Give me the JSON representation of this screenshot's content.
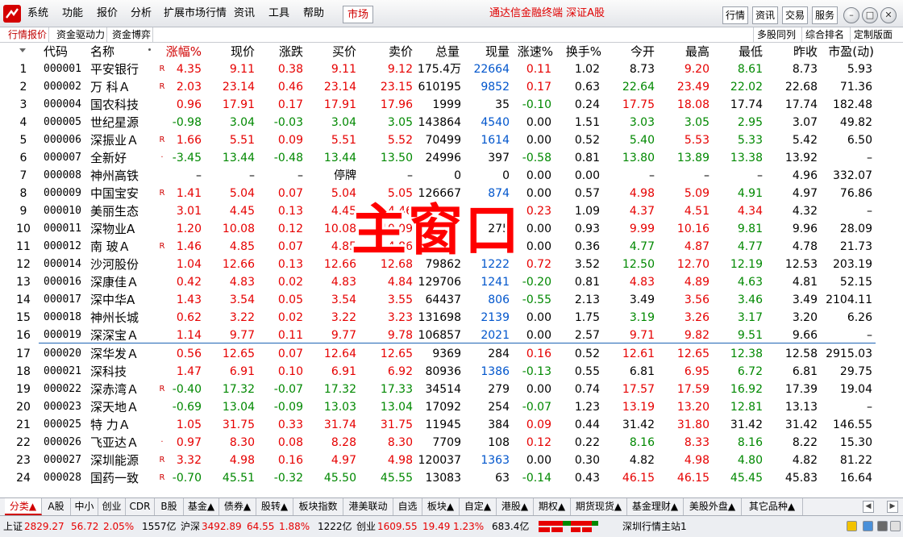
{
  "app": {
    "title": "通达信金融终端  深证A股",
    "market_button": "市场"
  },
  "menu": [
    "系统",
    "功能",
    "报价",
    "分析",
    "扩展市场行情",
    "资讯",
    "工具",
    "帮助"
  ],
  "right_buttons": [
    "行情",
    "资讯",
    "交易",
    "服务"
  ],
  "subtabs": [
    "行情报价",
    "资金驱动力",
    "资金博弈"
  ],
  "subtabs_right": [
    "多股同列",
    "综合排名",
    "定制版面"
  ],
  "columns": [
    "代码",
    "名称",
    "涨幅%",
    "现价",
    "涨跌",
    "买价",
    "卖价",
    "总量",
    "现量",
    "涨速%",
    "换手%",
    "今开",
    "最高",
    "最低",
    "昨收",
    "市盈(动)"
  ],
  "sorted_column": "涨幅%",
  "rows": [
    {
      "idx": "1",
      "code": "000001",
      "name": "平安银行",
      "mark": "R",
      "chg_pct": "4.35",
      "price": "9.11",
      "chg": "0.38",
      "bid": "9.11",
      "ask": "9.12",
      "vol": "175.4万",
      "cur": "22664",
      "speed": "0.11",
      "turn": "1.02",
      "open": "8.73",
      "high": "9.20",
      "low": "8.61",
      "prev": "8.73",
      "pe": "5.93",
      "cc": {
        "chg_pct": "r",
        "price": "r",
        "chg": "r",
        "bid": "r",
        "ask": "r",
        "cur": "b",
        "speed": "r",
        "open": "k",
        "high": "r",
        "low": "g"
      }
    },
    {
      "idx": "2",
      "code": "000002",
      "name": "万 科Ａ",
      "mark": "R",
      "chg_pct": "2.03",
      "price": "23.14",
      "chg": "0.46",
      "bid": "23.14",
      "ask": "23.15",
      "vol": "610195",
      "cur": "9852",
      "speed": "0.17",
      "turn": "0.63",
      "open": "22.64",
      "high": "23.49",
      "low": "22.02",
      "prev": "22.68",
      "pe": "71.36",
      "cc": {
        "chg_pct": "r",
        "price": "r",
        "chg": "r",
        "bid": "r",
        "ask": "r",
        "cur": "b",
        "speed": "r",
        "open": "g",
        "high": "r",
        "low": "g"
      }
    },
    {
      "idx": "3",
      "code": "000004",
      "name": "国农科技",
      "mark": "",
      "chg_pct": "0.96",
      "price": "17.91",
      "chg": "0.17",
      "bid": "17.91",
      "ask": "17.96",
      "vol": "1999",
      "cur": "35",
      "speed": "-0.10",
      "turn": "0.24",
      "open": "17.75",
      "high": "18.08",
      "low": "17.74",
      "prev": "17.74",
      "pe": "182.48",
      "cc": {
        "chg_pct": "r",
        "price": "r",
        "chg": "r",
        "bid": "r",
        "ask": "r",
        "cur": "k",
        "speed": "g",
        "open": "r",
        "high": "r",
        "low": "k"
      }
    },
    {
      "idx": "4",
      "code": "000005",
      "name": "世纪星源",
      "mark": "",
      "chg_pct": "-0.98",
      "price": "3.04",
      "chg": "-0.03",
      "bid": "3.04",
      "ask": "3.05",
      "vol": "143864",
      "cur": "4540",
      "speed": "0.00",
      "turn": "1.51",
      "open": "3.03",
      "high": "3.05",
      "low": "2.95",
      "prev": "3.07",
      "pe": "49.82",
      "cc": {
        "chg_pct": "g",
        "price": "g",
        "chg": "g",
        "bid": "g",
        "ask": "g",
        "cur": "b",
        "speed": "k",
        "open": "g",
        "high": "g",
        "low": "g"
      }
    },
    {
      "idx": "5",
      "code": "000006",
      "name": "深振业Ａ",
      "mark": "R",
      "chg_pct": "1.66",
      "price": "5.51",
      "chg": "0.09",
      "bid": "5.51",
      "ask": "5.52",
      "vol": "70499",
      "cur": "1614",
      "speed": "0.00",
      "turn": "0.52",
      "open": "5.40",
      "high": "5.53",
      "low": "5.33",
      "prev": "5.42",
      "pe": "6.50",
      "cc": {
        "chg_pct": "r",
        "price": "r",
        "chg": "r",
        "bid": "r",
        "ask": "r",
        "cur": "b",
        "speed": "k",
        "open": "g",
        "high": "r",
        "low": "g"
      }
    },
    {
      "idx": "6",
      "code": "000007",
      "name": "全新好",
      "mark": "·",
      "chg_pct": "-3.45",
      "price": "13.44",
      "chg": "-0.48",
      "bid": "13.44",
      "ask": "13.50",
      "vol": "24996",
      "cur": "397",
      "speed": "-0.58",
      "turn": "0.81",
      "open": "13.80",
      "high": "13.89",
      "low": "13.38",
      "prev": "13.92",
      "pe": "–",
      "cc": {
        "chg_pct": "g",
        "price": "g",
        "chg": "g",
        "bid": "g",
        "ask": "g",
        "cur": "k",
        "speed": "g",
        "open": "g",
        "high": "g",
        "low": "g"
      }
    },
    {
      "idx": "7",
      "code": "000008",
      "name": "神州高铁",
      "mark": "",
      "chg_pct": "–",
      "price": "–",
      "chg": "–",
      "bid": "停牌",
      "ask": "–",
      "vol": "0",
      "cur": "0",
      "speed": "0.00",
      "turn": "0.00",
      "open": "–",
      "high": "–",
      "low": "–",
      "prev": "4.96",
      "pe": "332.07",
      "cc": {
        "chg_pct": "k",
        "price": "k",
        "chg": "k",
        "bid": "k",
        "ask": "k",
        "cur": "k",
        "speed": "k",
        "open": "k",
        "high": "k",
        "low": "k"
      }
    },
    {
      "idx": "8",
      "code": "000009",
      "name": "中国宝安",
      "mark": "R",
      "chg_pct": "1.41",
      "price": "5.04",
      "chg": "0.07",
      "bid": "5.04",
      "ask": "5.05",
      "vol": "126667",
      "cur": "874",
      "speed": "0.00",
      "turn": "0.57",
      "open": "4.98",
      "high": "5.09",
      "low": "4.91",
      "prev": "4.97",
      "pe": "76.86",
      "cc": {
        "chg_pct": "r",
        "price": "r",
        "chg": "r",
        "bid": "r",
        "ask": "r",
        "cur": "b",
        "speed": "k",
        "open": "r",
        "high": "r",
        "low": "g"
      }
    },
    {
      "idx": "9",
      "code": "000010",
      "name": "美丽生态",
      "mark": "",
      "chg_pct": "3.01",
      "price": "4.45",
      "chg": "0.13",
      "bid": "4.45",
      "ask": "4.46",
      "vol": "",
      "cur": "",
      "speed": "0.23",
      "turn": "1.09",
      "open": "4.37",
      "high": "4.51",
      "low": "4.34",
      "prev": "4.32",
      "pe": "–",
      "cc": {
        "chg_pct": "r",
        "price": "r",
        "chg": "r",
        "bid": "r",
        "ask": "r",
        "cur": "b",
        "speed": "r",
        "open": "r",
        "high": "r",
        "low": "r"
      }
    },
    {
      "idx": "10",
      "code": "000011",
      "name": "深物业A",
      "mark": "",
      "chg_pct": "1.20",
      "price": "10.08",
      "chg": "0.12",
      "bid": "10.08",
      "ask": "10.09",
      "vol": "",
      "cur": "275",
      "speed": "0.00",
      "turn": "0.93",
      "open": "9.99",
      "high": "10.16",
      "low": "9.81",
      "prev": "9.96",
      "pe": "28.09",
      "cc": {
        "chg_pct": "r",
        "price": "r",
        "chg": "r",
        "bid": "r",
        "ask": "r",
        "cur": "k",
        "speed": "k",
        "open": "r",
        "high": "r",
        "low": "g"
      }
    },
    {
      "idx": "11",
      "code": "000012",
      "name": "南 玻Ａ",
      "mark": "R",
      "chg_pct": "1.46",
      "price": "4.85",
      "chg": "0.07",
      "bid": "4.85",
      "ask": "4.86",
      "vol": "",
      "cur": "",
      "speed": "0.00",
      "turn": "0.36",
      "open": "4.77",
      "high": "4.87",
      "low": "4.77",
      "prev": "4.78",
      "pe": "21.73",
      "cc": {
        "chg_pct": "r",
        "price": "r",
        "chg": "r",
        "bid": "r",
        "ask": "r",
        "cur": "b",
        "speed": "k",
        "open": "g",
        "high": "r",
        "low": "g"
      }
    },
    {
      "idx": "12",
      "code": "000014",
      "name": "沙河股份",
      "mark": "",
      "chg_pct": "1.04",
      "price": "12.66",
      "chg": "0.13",
      "bid": "12.66",
      "ask": "12.68",
      "vol": "79862",
      "cur": "1222",
      "speed": "0.72",
      "turn": "3.52",
      "open": "12.50",
      "high": "12.70",
      "low": "12.19",
      "prev": "12.53",
      "pe": "203.19",
      "cc": {
        "chg_pct": "r",
        "price": "r",
        "chg": "r",
        "bid": "r",
        "ask": "r",
        "cur": "b",
        "speed": "r",
        "open": "g",
        "high": "r",
        "low": "g"
      }
    },
    {
      "idx": "13",
      "code": "000016",
      "name": "深康佳Ａ",
      "mark": "",
      "chg_pct": "0.42",
      "price": "4.83",
      "chg": "0.02",
      "bid": "4.83",
      "ask": "4.84",
      "vol": "129706",
      "cur": "1241",
      "speed": "-0.20",
      "turn": "0.81",
      "open": "4.83",
      "high": "4.89",
      "low": "4.63",
      "prev": "4.81",
      "pe": "52.15",
      "cc": {
        "chg_pct": "r",
        "price": "r",
        "chg": "r",
        "bid": "r",
        "ask": "r",
        "cur": "b",
        "speed": "g",
        "open": "r",
        "high": "r",
        "low": "g"
      }
    },
    {
      "idx": "14",
      "code": "000017",
      "name": "深中华A",
      "mark": "",
      "chg_pct": "1.43",
      "price": "3.54",
      "chg": "0.05",
      "bid": "3.54",
      "ask": "3.55",
      "vol": "64437",
      "cur": "806",
      "speed": "-0.55",
      "turn": "2.13",
      "open": "3.49",
      "high": "3.56",
      "low": "3.46",
      "prev": "3.49",
      "pe": "2104.11",
      "cc": {
        "chg_pct": "r",
        "price": "r",
        "chg": "r",
        "bid": "r",
        "ask": "r",
        "cur": "b",
        "speed": "g",
        "open": "k",
        "high": "r",
        "low": "g"
      }
    },
    {
      "idx": "15",
      "code": "000018",
      "name": "神州长城",
      "mark": "",
      "chg_pct": "0.62",
      "price": "3.22",
      "chg": "0.02",
      "bid": "3.22",
      "ask": "3.23",
      "vol": "131698",
      "cur": "2139",
      "speed": "0.00",
      "turn": "1.75",
      "open": "3.19",
      "high": "3.26",
      "low": "3.17",
      "prev": "3.20",
      "pe": "6.26",
      "cc": {
        "chg_pct": "r",
        "price": "r",
        "chg": "r",
        "bid": "r",
        "ask": "r",
        "cur": "b",
        "speed": "k",
        "open": "g",
        "high": "r",
        "low": "g"
      }
    },
    {
      "idx": "16",
      "code": "000019",
      "name": "深深宝Ａ",
      "mark": "",
      "chg_pct": "1.14",
      "price": "9.77",
      "chg": "0.11",
      "bid": "9.77",
      "ask": "9.78",
      "vol": "106857",
      "cur": "2021",
      "speed": "0.00",
      "turn": "2.57",
      "open": "9.71",
      "high": "9.82",
      "low": "9.51",
      "prev": "9.66",
      "pe": "–",
      "cc": {
        "chg_pct": "r",
        "price": "r",
        "chg": "r",
        "bid": "r",
        "ask": "r",
        "cur": "b",
        "speed": "k",
        "open": "r",
        "high": "r",
        "low": "g"
      }
    },
    {
      "idx": "17",
      "code": "000020",
      "name": "深华发Ａ",
      "mark": "",
      "chg_pct": "0.56",
      "price": "12.65",
      "chg": "0.07",
      "bid": "12.64",
      "ask": "12.65",
      "vol": "9369",
      "cur": "284",
      "speed": "0.16",
      "turn": "0.52",
      "open": "12.61",
      "high": "12.65",
      "low": "12.38",
      "prev": "12.58",
      "pe": "2915.03",
      "cc": {
        "chg_pct": "r",
        "price": "r",
        "chg": "r",
        "bid": "r",
        "ask": "r",
        "cur": "k",
        "speed": "r",
        "open": "r",
        "high": "r",
        "low": "g"
      }
    },
    {
      "idx": "18",
      "code": "000021",
      "name": "深科技",
      "mark": "",
      "chg_pct": "1.47",
      "price": "6.91",
      "chg": "0.10",
      "bid": "6.91",
      "ask": "6.92",
      "vol": "80936",
      "cur": "1386",
      "speed": "-0.13",
      "turn": "0.55",
      "open": "6.81",
      "high": "6.95",
      "low": "6.72",
      "prev": "6.81",
      "pe": "29.75",
      "cc": {
        "chg_pct": "r",
        "price": "r",
        "chg": "r",
        "bid": "r",
        "ask": "r",
        "cur": "b",
        "speed": "g",
        "open": "k",
        "high": "r",
        "low": "g"
      }
    },
    {
      "idx": "19",
      "code": "000022",
      "name": "深赤湾Ａ",
      "mark": "R",
      "chg_pct": "-0.40",
      "price": "17.32",
      "chg": "-0.07",
      "bid": "17.32",
      "ask": "17.33",
      "vol": "34514",
      "cur": "279",
      "speed": "0.00",
      "turn": "0.74",
      "open": "17.57",
      "high": "17.59",
      "low": "16.92",
      "prev": "17.39",
      "pe": "19.04",
      "cc": {
        "chg_pct": "g",
        "price": "g",
        "chg": "g",
        "bid": "g",
        "ask": "g",
        "cur": "k",
        "speed": "k",
        "open": "r",
        "high": "r",
        "low": "g"
      }
    },
    {
      "idx": "20",
      "code": "000023",
      "name": "深天地Ａ",
      "mark": "",
      "chg_pct": "-0.69",
      "price": "13.04",
      "chg": "-0.09",
      "bid": "13.03",
      "ask": "13.04",
      "vol": "17092",
      "cur": "254",
      "speed": "-0.07",
      "turn": "1.23",
      "open": "13.19",
      "high": "13.20",
      "low": "12.81",
      "prev": "13.13",
      "pe": "–",
      "cc": {
        "chg_pct": "g",
        "price": "g",
        "chg": "g",
        "bid": "g",
        "ask": "g",
        "cur": "k",
        "speed": "g",
        "open": "r",
        "high": "r",
        "low": "g"
      }
    },
    {
      "idx": "21",
      "code": "000025",
      "name": "特 力Ａ",
      "mark": "",
      "chg_pct": "1.05",
      "price": "31.75",
      "chg": "0.33",
      "bid": "31.74",
      "ask": "31.75",
      "vol": "11945",
      "cur": "384",
      "speed": "0.09",
      "turn": "0.44",
      "open": "31.42",
      "high": "31.80",
      "low": "31.42",
      "prev": "31.42",
      "pe": "146.55",
      "cc": {
        "chg_pct": "r",
        "price": "r",
        "chg": "r",
        "bid": "r",
        "ask": "r",
        "cur": "k",
        "speed": "r",
        "open": "k",
        "high": "r",
        "low": "k"
      }
    },
    {
      "idx": "22",
      "code": "000026",
      "name": "飞亚达Ａ",
      "mark": "·",
      "chg_pct": "0.97",
      "price": "8.30",
      "chg": "0.08",
      "bid": "8.28",
      "ask": "8.30",
      "vol": "7709",
      "cur": "108",
      "speed": "0.12",
      "turn": "0.22",
      "open": "8.16",
      "high": "8.33",
      "low": "8.16",
      "prev": "8.22",
      "pe": "15.30",
      "cc": {
        "chg_pct": "r",
        "price": "r",
        "chg": "r",
        "bid": "r",
        "ask": "r",
        "cur": "k",
        "speed": "r",
        "open": "g",
        "high": "r",
        "low": "g"
      }
    },
    {
      "idx": "23",
      "code": "000027",
      "name": "深圳能源",
      "mark": "R",
      "chg_pct": "3.32",
      "price": "4.98",
      "chg": "0.16",
      "bid": "4.97",
      "ask": "4.98",
      "vol": "120037",
      "cur": "1363",
      "speed": "0.00",
      "turn": "0.30",
      "open": "4.82",
      "high": "4.98",
      "low": "4.80",
      "prev": "4.82",
      "pe": "81.22",
      "cc": {
        "chg_pct": "r",
        "price": "r",
        "chg": "r",
        "bid": "r",
        "ask": "r",
        "cur": "b",
        "speed": "k",
        "open": "k",
        "high": "r",
        "low": "g"
      }
    },
    {
      "idx": "24",
      "code": "000028",
      "name": "国药一致",
      "mark": "R",
      "chg_pct": "-0.70",
      "price": "45.51",
      "chg": "-0.32",
      "bid": "45.50",
      "ask": "45.55",
      "vol": "13083",
      "cur": "63",
      "speed": "-0.14",
      "turn": "0.43",
      "open": "46.15",
      "high": "46.15",
      "low": "45.45",
      "prev": "45.83",
      "pe": "16.64",
      "cc": {
        "chg_pct": "g",
        "price": "g",
        "chg": "g",
        "bid": "g",
        "ask": "g",
        "cur": "k",
        "speed": "g",
        "open": "r",
        "high": "r",
        "low": "g"
      }
    }
  ],
  "overlay": {
    "text": "主窗口"
  },
  "categories": [
    "分类▲",
    "A股",
    "中小",
    "创业",
    "CDR",
    "B股",
    "基金▲",
    "债券▲",
    "股转▲",
    "板块指数",
    "港美联动",
    "自选",
    "板块▲",
    "自定▲",
    "港股▲",
    "期权▲",
    "期货现货▲",
    "基金理财▲",
    "美股外盘▲",
    "其它品种▲"
  ],
  "status": {
    "sh_label": "上证",
    "sh_index": "2829.27",
    "sh_chg": "56.72",
    "sh_pct": "2.05%",
    "sh_amount": "1557亿",
    "sz_label": "沪深",
    "sz_index": "3492.89",
    "sz_chg": "64.55",
    "sz_pct": "1.88%",
    "sz_amount": "1222亿",
    "cy_label": "创业",
    "cy_index": "1609.55",
    "cy_chg": "19.49",
    "cy_pct": "1.23%",
    "cy_amount": "683.4亿",
    "server": "深圳行情主站1"
  },
  "colors": {
    "up": "#e60000",
    "down": "#008800",
    "volume": "#0055cc",
    "accent": "#d00000"
  }
}
